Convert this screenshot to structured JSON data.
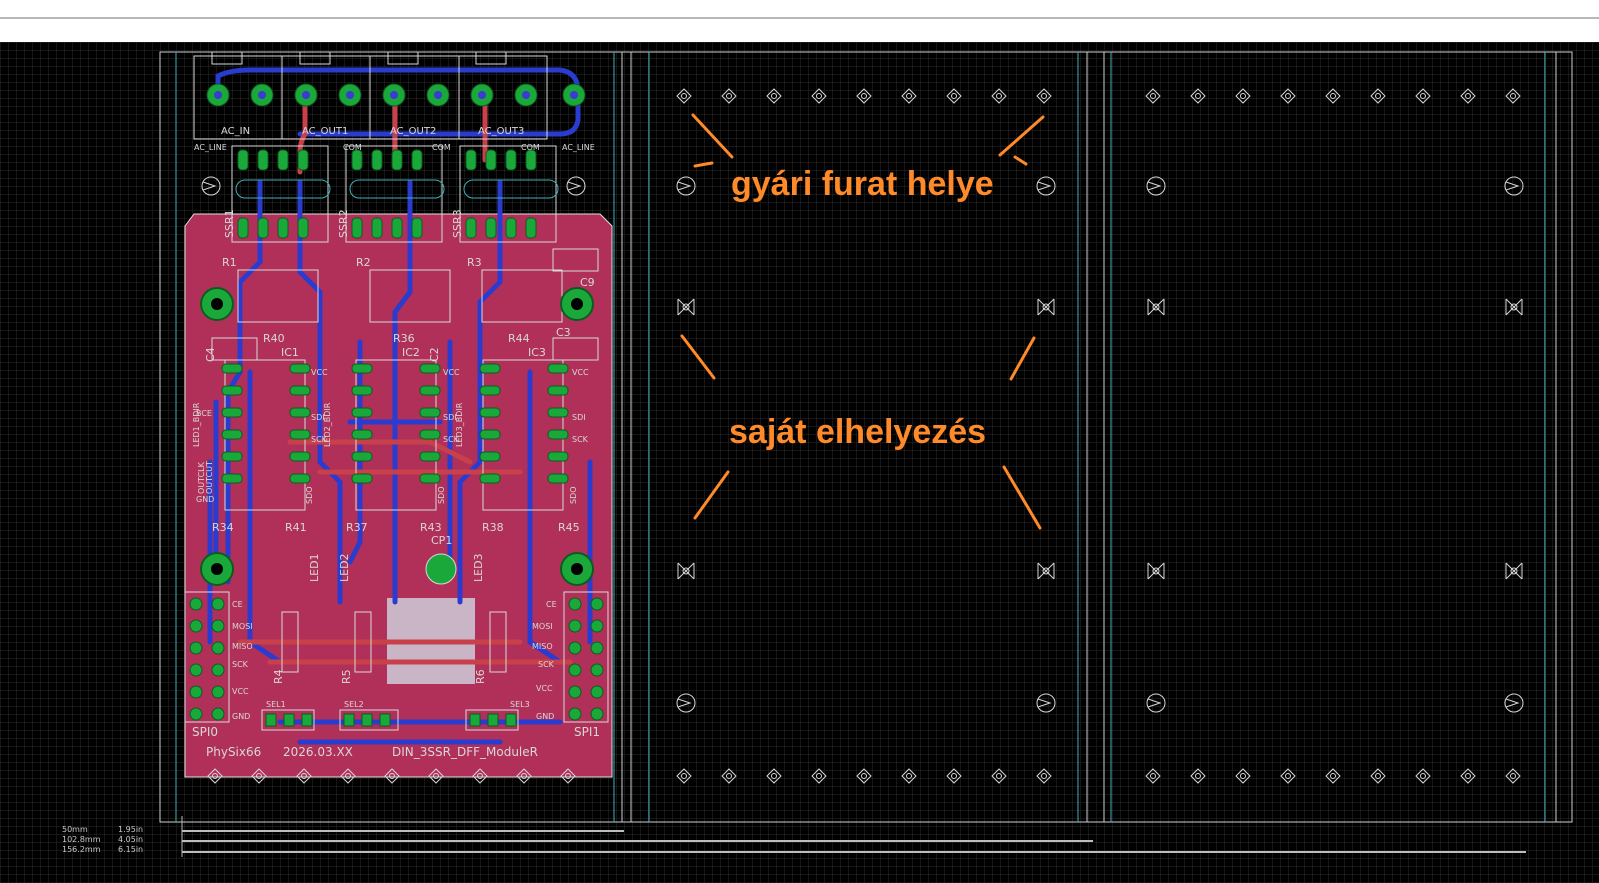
{
  "colors": {
    "background": "#000000",
    "grid": "#2b2b2b",
    "board_fill": "#b0305a",
    "top_copper": "#c8404a",
    "bottom_copper": "#2a3bd0",
    "pad": "#1aa83a",
    "silkscreen": "#d8d8d8",
    "annotation": "#ff8a2a",
    "rail": "#3fb0b8"
  },
  "annotations": {
    "factory_hole": "gyári furat helye",
    "own_placement": "saját elhelyezés"
  },
  "board": {
    "connectors": [
      "AC_IN",
      "AC_OUT1",
      "AC_OUT2",
      "AC_OUT3"
    ],
    "terminal_labels": [
      "AC_LINE",
      "COM",
      "COM",
      "COM",
      "AC_LINE"
    ],
    "relays": [
      "SSR1",
      "SSR2",
      "SSR3"
    ],
    "resistors_top": [
      "R1",
      "R2",
      "R3"
    ],
    "caps_right": [
      "C9",
      "C3"
    ],
    "ics": [
      "IC1",
      "IC2",
      "IC3"
    ],
    "mid_refs": [
      "R40",
      "R36",
      "R44",
      "C4",
      "C2"
    ],
    "pin_left": [
      "BCE",
      "OUTCLK",
      "GND",
      "OUTCUT"
    ],
    "pin_right": [
      "VCC",
      "SDI",
      "SCK",
      "SDO"
    ],
    "led_dir": [
      "LED1_BDIR",
      "LED2_BDIR",
      "LED3_BDIR"
    ],
    "lower_refs": [
      "R34",
      "R41",
      "R37",
      "R43",
      "R38",
      "R45",
      "CP1"
    ],
    "leds": [
      "LED1",
      "LED2",
      "LED3"
    ],
    "spi_left": [
      "CE",
      "MOSI",
      "MISO",
      "SCK",
      "VCC",
      "GND"
    ],
    "spi_right": [
      "CE",
      "MOSI",
      "MISO",
      "SCK",
      "VCC",
      "GND"
    ],
    "bottom_res": [
      "R4",
      "R5",
      "R6"
    ],
    "selectors": [
      "SEL1",
      "SEL2",
      "SEL3"
    ],
    "spi_names": [
      "SPI0",
      "SPI1"
    ],
    "footer": [
      "PhySix66",
      "2026.03.XX",
      "DIN_3SSR_DFF_ModuleR"
    ]
  },
  "measurements": [
    {
      "mm": "50mm",
      "inch": "1.95in"
    },
    {
      "mm": "102.8mm",
      "inch": "4.05in"
    },
    {
      "mm": "156.2mm",
      "inch": "6.15in"
    }
  ]
}
